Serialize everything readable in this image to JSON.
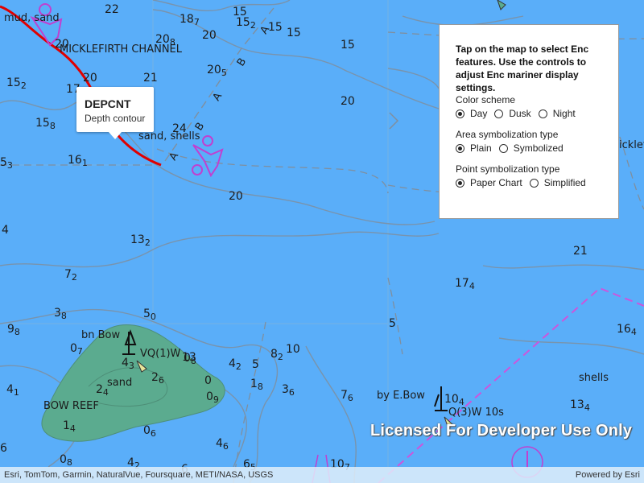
{
  "map": {
    "soundings": [
      {
        "v": "22",
        "s": ""
      },
      {
        "v": "18",
        "s": "7"
      },
      {
        "v": "15",
        "s": ""
      },
      {
        "v": "15",
        "s": "2"
      },
      {
        "v": "15",
        "s": ""
      },
      {
        "v": "15",
        "s": ""
      },
      {
        "v": "20",
        "s": ""
      },
      {
        "v": "20",
        "s": "8"
      },
      {
        "v": "15",
        "s": ""
      },
      {
        "v": "20",
        "s": ""
      },
      {
        "v": "15",
        "s": "2"
      },
      {
        "v": "17",
        "s": ""
      },
      {
        "v": "20",
        "s": "5"
      },
      {
        "v": "21",
        "s": ""
      },
      {
        "v": "15",
        "s": "8"
      },
      {
        "v": "20",
        "s": ""
      },
      {
        "v": "24",
        "s": ""
      },
      {
        "v": "5",
        "s": "3"
      },
      {
        "v": "16",
        "s": "1"
      },
      {
        "v": "20",
        "s": ""
      },
      {
        "v": "20",
        "s": ""
      },
      {
        "v": "4",
        "s": ""
      },
      {
        "v": "13",
        "s": "2"
      },
      {
        "v": "7",
        "s": "2"
      },
      {
        "v": "3",
        "s": "8"
      },
      {
        "v": "5",
        "s": "0"
      },
      {
        "v": "9",
        "s": "8"
      },
      {
        "v": "0",
        "s": "7"
      },
      {
        "v": "4",
        "s": "3"
      },
      {
        "v": "13",
        "s": ""
      },
      {
        "v": "0",
        "s": "8"
      },
      {
        "v": "8",
        "s": "2"
      },
      {
        "v": "10",
        "s": ""
      },
      {
        "v": "4",
        "s": "2"
      },
      {
        "v": "5",
        "s": ""
      },
      {
        "v": "2",
        "s": "6"
      },
      {
        "v": "0",
        "s": ""
      },
      {
        "v": "0",
        "s": "9"
      },
      {
        "v": "1",
        "s": "8"
      },
      {
        "v": "3",
        "s": "6"
      },
      {
        "v": "2",
        "s": "4"
      },
      {
        "v": "4",
        "s": "1"
      },
      {
        "v": "1",
        "s": "4"
      },
      {
        "v": "0",
        "s": "6"
      },
      {
        "v": "7",
        "s": "6"
      },
      {
        "v": "4",
        "s": "6"
      },
      {
        "v": "6",
        "s": ""
      },
      {
        "v": "6",
        "s": "5"
      },
      {
        "v": "6",
        "s": ""
      },
      {
        "v": "0",
        "s": "8"
      },
      {
        "v": "4",
        "s": "2"
      },
      {
        "v": "10",
        "s": "7"
      },
      {
        "v": "17",
        "s": "4"
      },
      {
        "v": "21",
        "s": ""
      },
      {
        "v": "16",
        "s": "4"
      },
      {
        "v": "13",
        "s": "4"
      },
      {
        "v": "10",
        "s": "4"
      },
      {
        "v": "5",
        "s": ""
      }
    ],
    "labels": {
      "mud_sand": "mud, sand",
      "channel": "MICKLEFIRTH CHANNEL",
      "sand_shells": "sand, shells",
      "bn_bow": "bn Bow",
      "vq_light": "VQ(1)W",
      "sand": "sand",
      "bow_reef": "BOW REEF",
      "by_ebow": "by E.Bow",
      "q3_light": "Q(3)W 10s",
      "shells": "shells",
      "icklefir": "icklefir",
      "route_letters": [
        "A",
        "B",
        "A",
        "B",
        "A"
      ]
    },
    "watermark": "Licensed For Developer Use Only"
  },
  "callout": {
    "title": "DEPCNT",
    "subtitle": "Depth contour"
  },
  "panel": {
    "instructions": "Tap on the map to select Enc features. Use the controls to adjust Enc mariner display settings.",
    "groups": [
      {
        "title": "Color scheme",
        "options": [
          {
            "label": "Day",
            "selected": true
          },
          {
            "label": "Dusk",
            "selected": false
          },
          {
            "label": "Night",
            "selected": false
          }
        ]
      },
      {
        "title": "Area symbolization type",
        "options": [
          {
            "label": "Plain",
            "selected": true
          },
          {
            "label": "Symbolized",
            "selected": false
          }
        ]
      },
      {
        "title": "Point symbolization type",
        "options": [
          {
            "label": "Paper Chart",
            "selected": true
          },
          {
            "label": "Simplified",
            "selected": false
          }
        ]
      }
    ]
  },
  "attribution": {
    "sources": "Esri, TomTom, Garmin, NaturalVue, Foursquare, METI/NASA, USGS",
    "powered": "Powered by Esri"
  },
  "colors": {
    "water": "#5aaef9",
    "reef": "#5bab8f",
    "contour": "#7a8ea0",
    "route": "#c060c8",
    "highlight": "#e00000",
    "limit": "#c060e0"
  }
}
